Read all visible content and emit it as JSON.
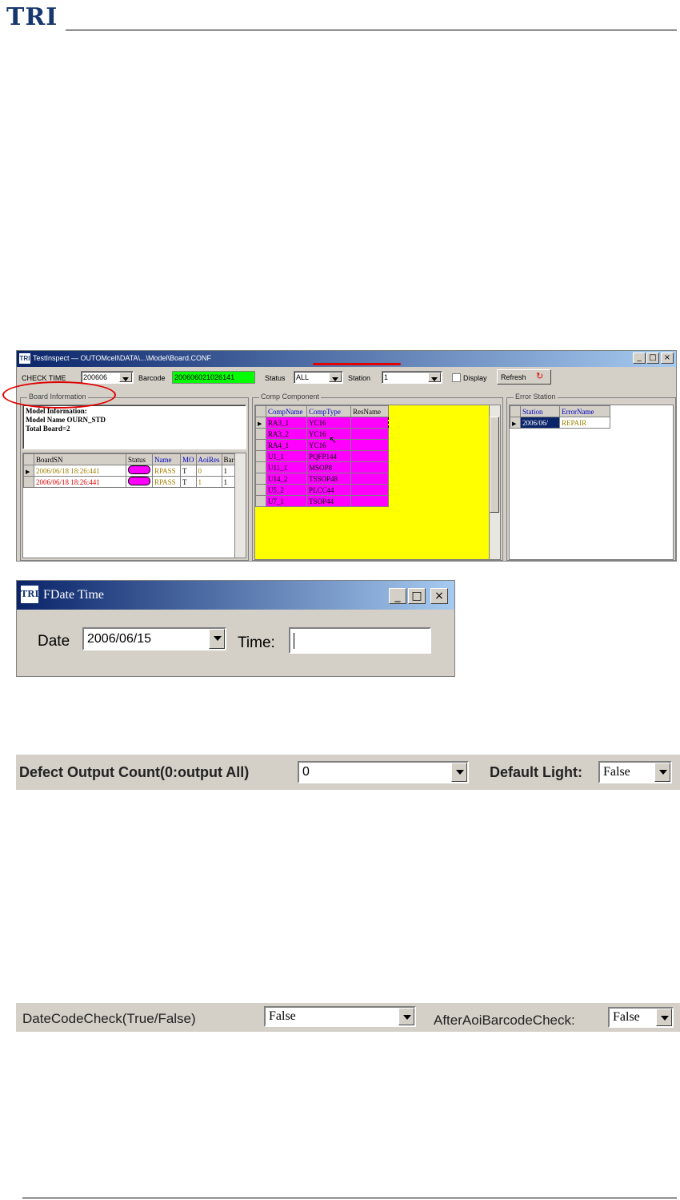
{
  "page": {
    "logo": "TRI"
  },
  "main_window": {
    "title": "TestInspect — OUTOMcell\\DATA\\...\\Model\\Board.CONF",
    "toolbar": {
      "check_time_label": "CHECK TIME",
      "check_time_value": "200606",
      "barcode_label": "Barcode",
      "barcode_value": "200606021026141",
      "status_label": "Status",
      "status_value": "ALL",
      "station_label": "Station",
      "station_value": "1",
      "display_label": "Display",
      "refresh_label": "Refresh"
    },
    "board_info": {
      "caption": "Board Information",
      "lines": [
        "Model Information:",
        "Model Name OURN_STD",
        "Total Board=2"
      ],
      "columns": [
        "BoardSN",
        "Status",
        "Name",
        "MO",
        "AoiRes",
        "Bar"
      ],
      "rows": [
        {
          "sn": "2006/06/18 18:26:441",
          "name": "RPASS",
          "mo": "T",
          "res": "0",
          "bar": "1"
        },
        {
          "sn": "2006/06/18 18:26:441",
          "name": "RPASS",
          "mo": "T",
          "res": "1",
          "bar": "1"
        }
      ]
    },
    "component_info": {
      "caption": "Comp Component",
      "columns": [
        "CompName",
        "CompType",
        "ResName"
      ],
      "rows": [
        {
          "name": "RA3_1",
          "type": "YC16"
        },
        {
          "name": "RA3_2",
          "type": "YC16"
        },
        {
          "name": "RA4_1",
          "type": "YC16"
        },
        {
          "name": "U1_1",
          "type": "PQFP144"
        },
        {
          "name": "U11_1",
          "type": "MSOP8"
        },
        {
          "name": "U14_2",
          "type": "TSSOP48"
        },
        {
          "name": "U5_2",
          "type": "PLCC44"
        },
        {
          "name": "U7_1",
          "type": "TSOP44"
        }
      ]
    },
    "error_info": {
      "caption": "Error Station",
      "columns": [
        "Station",
        "ErrorName"
      ],
      "rows": [
        {
          "station": "2006/06/",
          "error": "REPAIR"
        }
      ]
    }
  },
  "fdate_window": {
    "title": "FDate Time",
    "date_label": "Date",
    "date_value": "2006/06/15",
    "time_label": "Time:",
    "time_value": ""
  },
  "defect_bar": {
    "label": "Defect Output Count(0:output All)",
    "value": "0",
    "light_label": "Default Light:",
    "light_value": "False"
  },
  "datecode_bar": {
    "label": "DateCodeCheck(True/False)",
    "value": "False",
    "aoi_label": "AfterAoiBarcodeCheck:",
    "aoi_value": "False"
  },
  "colors": {
    "highlight": "#ff00ff",
    "background_panel": "#ffff00",
    "barcode_field": "#00ff00",
    "titlebar_start": "#0a246a",
    "titlebar_end": "#a6caf0",
    "annotation_red": "#e00000"
  }
}
